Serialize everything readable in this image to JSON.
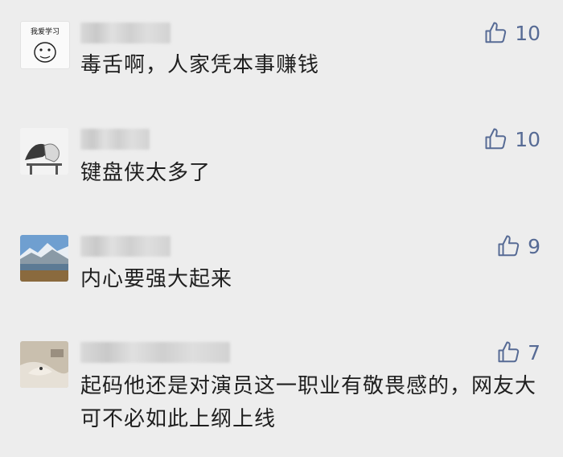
{
  "comments": [
    {
      "text": "毒舌啊，人家凭本事赚钱",
      "likes": "10",
      "avatar_label": "我爱学习"
    },
    {
      "text": "键盘侠太多了",
      "likes": "10"
    },
    {
      "text": "内心要强大起来",
      "likes": "9"
    },
    {
      "text": "起码他还是对演员这一职业有敬畏感的，网友大可不必如此上纲上线",
      "likes": "7"
    }
  ],
  "icons": {
    "like": "thumbs-up-icon"
  },
  "colors": {
    "background": "#ededed",
    "like": "#576b95",
    "text": "#1f1f1f"
  }
}
